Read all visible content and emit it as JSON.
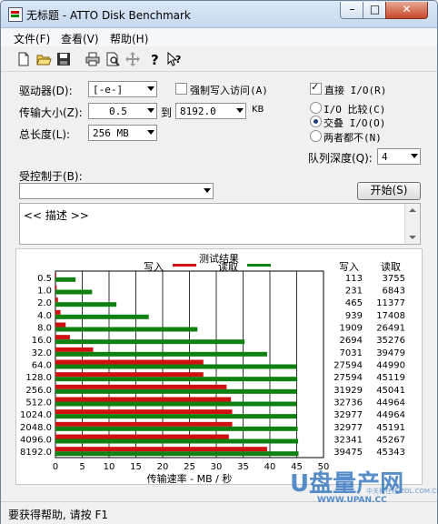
{
  "window": {
    "title": "无标题 - ATTO Disk Benchmark",
    "minimize": "–",
    "maximize": "□",
    "close": "✕"
  },
  "menu": [
    "文件(F)",
    "查看(V)",
    "帮助(H)"
  ],
  "toolbar": [
    "new-icon",
    "open-icon",
    "save-icon",
    "print-icon",
    "print-preview-icon",
    "move-icon",
    "help-icon",
    "context-help-icon"
  ],
  "settings": {
    "drive_label": "驱动器(D):",
    "drive_value": "[-e-]",
    "force_write_label": "强制写入访问(A)",
    "force_write_checked": false,
    "transfer_label": "传输大小(Z):",
    "transfer_from": "0.5",
    "to_label": "到",
    "transfer_to": "8192.0",
    "transfer_unit": "KB",
    "total_label": "总长度(L):",
    "total_value": "256 MB",
    "direct_io_label": "直接 I/O(R)",
    "direct_io_checked": true,
    "radio_options": [
      "I/O 比较(C)",
      "交叠 I/O(O)",
      "两者都不(N)"
    ],
    "radio_selected": 1,
    "queue_label": "队列深度(Q):",
    "queue_value": "4",
    "controlled_label": "受控制于(B):",
    "controlled_value": "",
    "start_button": "开始(S)",
    "description": "<< 描述 >>"
  },
  "chart_data": {
    "type": "bar",
    "title": "测试结果",
    "legend": [
      "写入",
      "读取"
    ],
    "colors": {
      "write": "#d01010",
      "read": "#108010"
    },
    "categories": [
      "0.5",
      "1.0",
      "2.0",
      "4.0",
      "8.0",
      "16.0",
      "32.0",
      "64.0",
      "128.0",
      "256.0",
      "512.0",
      "1024.0",
      "2048.0",
      "4096.0",
      "8192.0"
    ],
    "series": [
      {
        "name": "写入",
        "values": [
          113,
          231,
          465,
          939,
          1909,
          2694,
          7031,
          27594,
          27594,
          31929,
          32736,
          32977,
          32977,
          32341,
          39475
        ]
      },
      {
        "name": "读取",
        "values": [
          3755,
          6843,
          11377,
          17408,
          26491,
          35276,
          39479,
          44990,
          45119,
          45041,
          44964,
          44964,
          45191,
          45267,
          45343
        ]
      }
    ],
    "column_headers": [
      "写入",
      "读取"
    ],
    "xlabel": "传输速率 - MB / 秒",
    "xticks": [
      "0",
      "5",
      "10",
      "15",
      "20",
      "25",
      "30",
      "35",
      "40",
      "45",
      "50"
    ],
    "xlim": [
      0,
      50
    ]
  },
  "watermark": {
    "brand": "U盘量产网",
    "url": "WWW.UPAN.CC",
    "sub": "中关村在线 ZOL.COM.CN"
  },
  "status": "要获得帮助, 请按 F1"
}
